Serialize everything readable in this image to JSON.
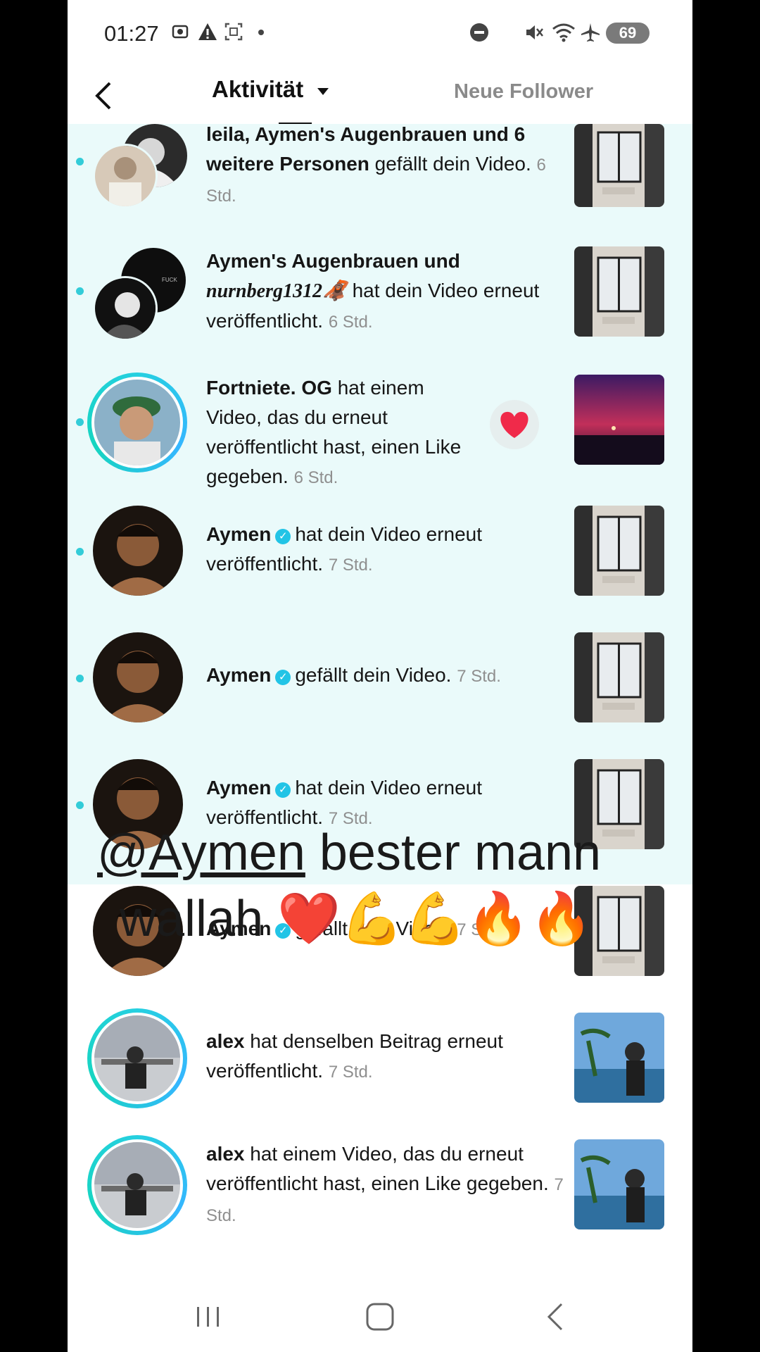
{
  "status_bar": {
    "time": "01:27",
    "battery": "69",
    "icons": [
      "screenshot-icon",
      "warning-icon",
      "screen-record-icon",
      "dot-icon",
      "dnd-icon",
      "mute-icon",
      "wifi-icon",
      "airplane-icon",
      "battery-icon"
    ]
  },
  "header": {
    "title": "Aktivität",
    "right_tab": "Neue Follower"
  },
  "notifications": [
    {
      "actor": "leila, Aymen's Augenbrauen und 6 weitere Personen",
      "action": "gefällt dein Video.",
      "time": "6 Std.",
      "unread": true
    },
    {
      "actor": "Aymen's Augenbrauen und",
      "actor2": "nurnberg1312🦧",
      "action": "hat dein Video erneut veröffentlicht.",
      "time": "6 Std.",
      "unread": true
    },
    {
      "actor": "Fortniete.    OG",
      "action": "hat einem Video, das du erneut veröffentlicht hast, einen Like gegeben.",
      "time": "6 Std.",
      "unread": true,
      "reaction": "❤️"
    },
    {
      "actor": "Aymen",
      "action": "hat dein Video erneut veröffentlicht.",
      "time": "7 Std.",
      "unread": true,
      "verified": true
    },
    {
      "actor": "Aymen",
      "action": "gefällt dein Video.",
      "time": "7 Std.",
      "unread": true,
      "verified": true
    },
    {
      "actor": "Aymen",
      "action": "hat dein Video erneut veröffentlicht.",
      "time": "7 Std.",
      "unread": true,
      "verified": true
    },
    {
      "actor": "Aymen",
      "action": "gefällt dein Video.",
      "time": "7 Std.",
      "unread": false,
      "verified": true
    },
    {
      "actor": "alex",
      "action": "hat denselben Beitrag erneut veröffentlicht.",
      "time": "7 Std.",
      "unread": false
    },
    {
      "actor": "alex",
      "action": "hat einem Video, das du erneut veröffentlicht hast, einen Like gegeben.",
      "time": "7 Std.",
      "unread": false
    }
  ],
  "overlay": {
    "mention": "@Aymen",
    "line1_rest": " bester mann",
    "line2": "wallah ❤️💪💪🔥🔥"
  },
  "nav": {
    "icons": [
      "recent-apps-icon",
      "home-icon",
      "back-icon"
    ]
  },
  "colors": {
    "unread_bg": "#eafafa",
    "accent": "#26d0e0",
    "verified": "#22c4e6"
  }
}
